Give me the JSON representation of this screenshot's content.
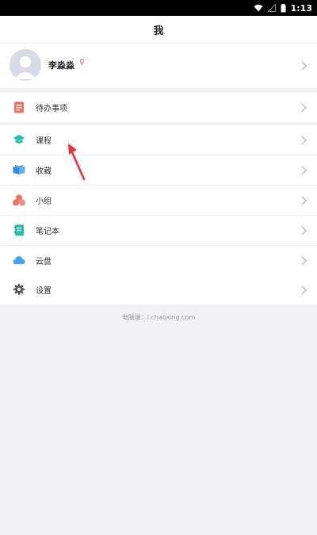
{
  "status_bar": {
    "time": "1:13"
  },
  "header": {
    "title": "我"
  },
  "profile": {
    "name": "李淼淼",
    "gender_symbol": "♀"
  },
  "menu": {
    "todo": {
      "label": "待办事项",
      "icon": "todo-icon",
      "color": "#f0715f"
    },
    "courses": {
      "label": "课程",
      "icon": "graduation-cap-icon",
      "color": "#23c1a9"
    },
    "favorites": {
      "label": "收藏",
      "icon": "book-icon",
      "color": "#2e8ee6"
    },
    "groups": {
      "label": "小组",
      "icon": "group-icon",
      "color": "#f0715f"
    },
    "notebook": {
      "label": "笔记本",
      "icon": "notebook-icon",
      "color": "#23c1a9"
    },
    "cloud": {
      "label": "云盘",
      "icon": "cloud-icon",
      "color": "#3fa6ec"
    },
    "settings": {
      "label": "设置",
      "icon": "gear-icon",
      "color": "#555555"
    }
  },
  "footer": {
    "text": "电脑端：i.chaoxing.com"
  },
  "colors": {
    "background": "#f2f2f4",
    "annotation_arrow": "#e8323c"
  }
}
